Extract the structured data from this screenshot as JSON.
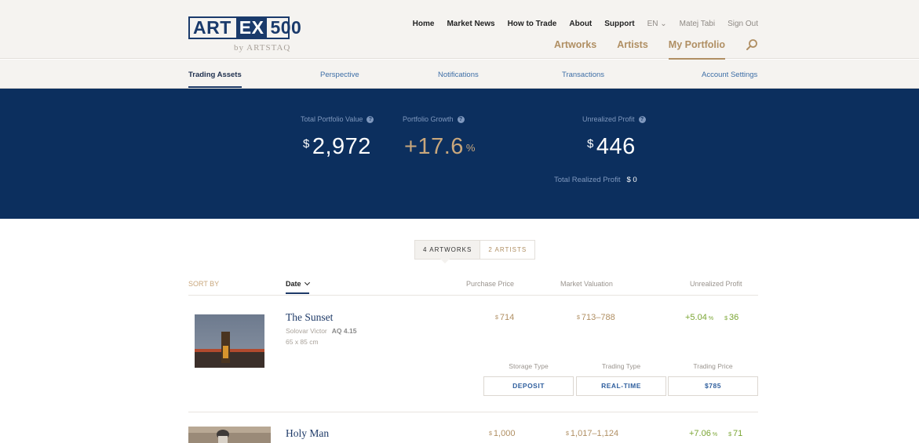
{
  "header": {
    "logo": {
      "art": "ART",
      "ex": "EX",
      "num": "500",
      "by": "by ARTSTAQ"
    },
    "top_nav": {
      "home": "Home",
      "market_news": "Market News",
      "how_to_trade": "How to Trade",
      "about": "About",
      "support": "Support",
      "language": "EN",
      "user": "Matej Tabi",
      "sign_out": "Sign Out"
    },
    "main_nav": {
      "artworks": "Artworks",
      "artists": "Artists",
      "my_portfolio": "My Portfolio"
    }
  },
  "sub_nav": {
    "trading_assets": "Trading Assets",
    "perspective": "Perspective",
    "notifications": "Notifications",
    "transactions": "Transactions",
    "account_settings": "Account Settings"
  },
  "summary": {
    "total_value_label": "Total Portfolio Value",
    "total_value_currency": "$",
    "total_value": "2,972",
    "growth_label": "Portfolio Growth",
    "growth": "+17.6",
    "growth_unit": "%",
    "unrealized_label": "Unrealized Profit",
    "unrealized_currency": "$",
    "unrealized": "446",
    "realized_label": "Total Realized Profit",
    "realized": "$ 0"
  },
  "toggle": {
    "artworks": "4 ARTWORKS",
    "artists": "2 ARTISTS"
  },
  "table_head": {
    "sort_by": "SORT BY",
    "date": "Date",
    "purchase_price": "Purchase Price",
    "market_valuation": "Market Valuation",
    "unrealized_profit": "Unrealized Profit"
  },
  "rows": [
    {
      "title": "The Sunset",
      "artist": "Solovar Victor",
      "aq": "AQ 4.15",
      "size": "65 x 85 cm",
      "purchase_currency": "$",
      "purchase": "714",
      "valuation_currency": "$",
      "valuation": "713–788",
      "profit_pct": "+5.04",
      "profit_pct_unit": "%",
      "profit_currency": "$",
      "profit_amt": "36",
      "storage_label": "Storage Type",
      "storage": "DEPOSIT",
      "trading_type_label": "Trading Type",
      "trading_type": "REAL-TIME",
      "trading_price_label": "Trading Price",
      "trading_price": "$785"
    },
    {
      "title": "Holy Man",
      "purchase_currency": "$",
      "purchase": "1,000",
      "valuation_currency": "$",
      "valuation": "1,017–1,124",
      "profit_pct": "+7.06",
      "profit_pct_unit": "%",
      "profit_currency": "$",
      "profit_amt": "71"
    }
  ],
  "colors": {
    "navy": "#0c2f5e",
    "gold": "#b08f63",
    "green": "#7aa533",
    "link_blue": "#3d6ea6"
  }
}
